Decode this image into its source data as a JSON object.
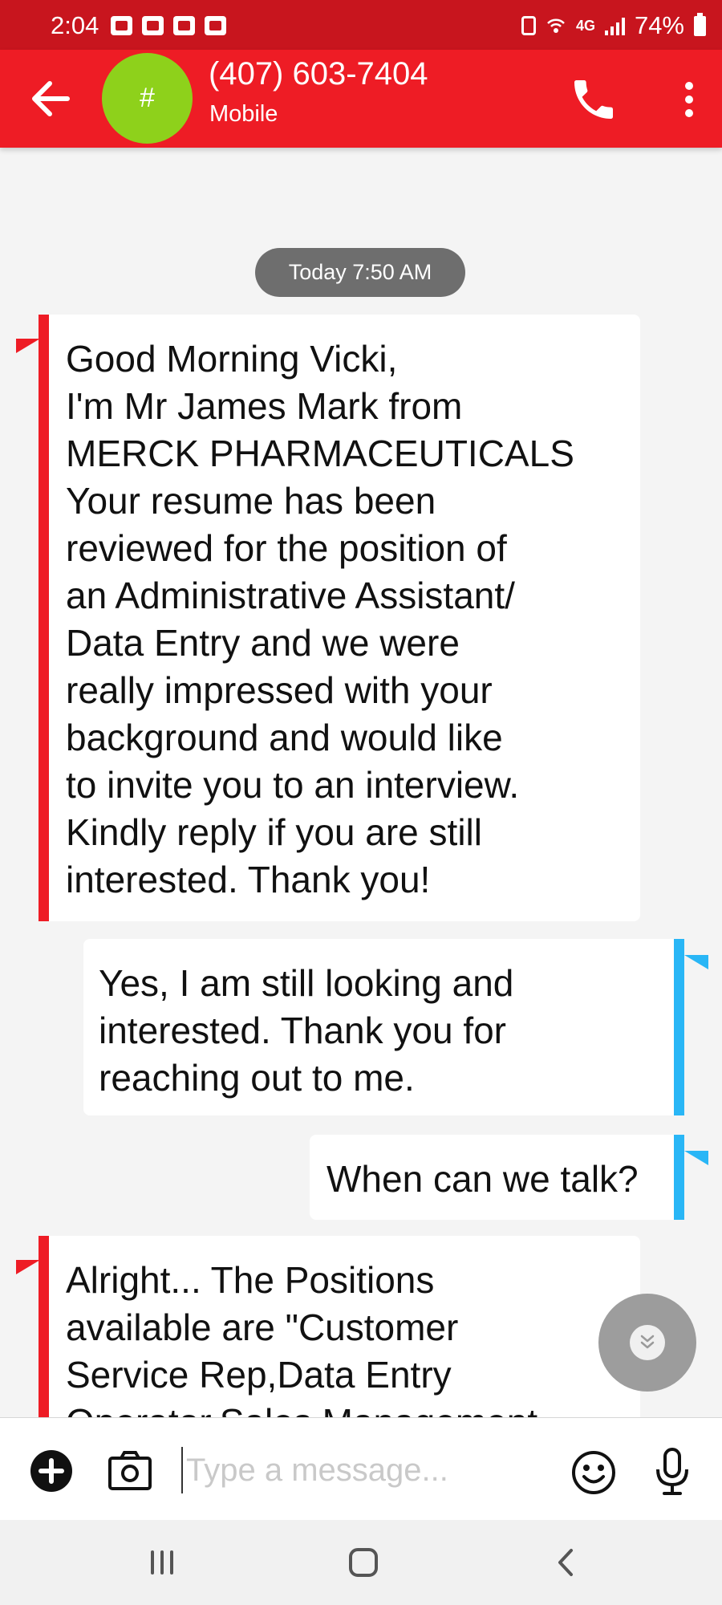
{
  "status_bar": {
    "time": "2:04",
    "network": "4G",
    "battery": "74%"
  },
  "header": {
    "title": "(407) 603-7404",
    "subtitle": "Mobile",
    "avatar_text": "#"
  },
  "conversation": {
    "timestamp": "Today 7:50 AM",
    "messages": [
      {
        "direction": "incoming",
        "text": "Good Morning Vicki,\nI'm Mr James Mark from\nMERCK PHARMACEUTICALS\nYour resume has been\nreviewed for the position of\nan Administrative Assistant/\nData Entry and we were\nreally impressed with your\nbackground and would like\nto invite you to an interview.\nKindly reply if you are still\ninterested. Thank you!"
      },
      {
        "direction": "outgoing",
        "text": "Yes, I am still looking and\ninterested. Thank you for\nreaching out to me."
      },
      {
        "direction": "outgoing",
        "text": "When can we talk?"
      },
      {
        "direction": "incoming",
        "text": "Alright... The Positions\navailable are \"Customer\nService Rep,Data Entry\nOperator,Sales Management"
      }
    ]
  },
  "composer": {
    "placeholder": "Type a message..."
  },
  "colors": {
    "header": "#ee1c25",
    "status_bar": "#c8151e",
    "incoming_accent": "#ee1c25",
    "outgoing_accent": "#29b6f6",
    "avatar": "#8ed11b"
  },
  "icons": {
    "back": "arrow-left-icon",
    "call": "phone-icon",
    "more": "more-vertical-icon",
    "add": "plus-circle-icon",
    "camera": "camera-icon",
    "emoji": "smiley-icon",
    "mic": "microphone-icon",
    "scroll": "chevron-double-down-icon",
    "nav_recents": "recents-icon",
    "nav_home": "home-icon",
    "nav_back": "nav-back-icon"
  }
}
